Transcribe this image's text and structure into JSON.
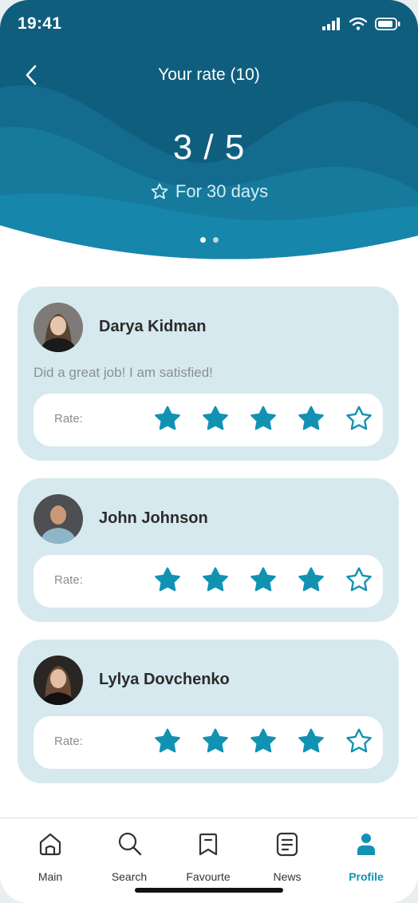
{
  "status_bar": {
    "time": "19:41"
  },
  "header": {
    "title": "Your rate (10)",
    "rate": "3 / 5",
    "period": "For 30 days",
    "pager": {
      "pages": 2,
      "active": 1
    }
  },
  "reviews": [
    {
      "name": "Darya Kidman",
      "comment": "Did a great job! I am satisfied!",
      "rate_label": "Rate:",
      "rating": 4,
      "max": 5
    },
    {
      "name": "John Johnson",
      "comment": "",
      "rate_label": "Rate:",
      "rating": 4,
      "max": 5
    },
    {
      "name": "Lylya Dovchenko",
      "comment": "",
      "rate_label": "Rate:",
      "rating": 4,
      "max": 5
    }
  ],
  "tabbar": {
    "items": [
      {
        "label": "Main",
        "icon": "home-icon"
      },
      {
        "label": "Search",
        "icon": "search-icon"
      },
      {
        "label": "Favourte",
        "icon": "bookmark-icon"
      },
      {
        "label": "News",
        "icon": "news-icon"
      },
      {
        "label": "Profile",
        "icon": "profile-icon"
      }
    ],
    "active": "Profile"
  },
  "colors": {
    "header_dark": "#0f5a79",
    "header_mid": "#136f91",
    "accent": "#1292b2",
    "card_bg": "#d6e9ef"
  }
}
